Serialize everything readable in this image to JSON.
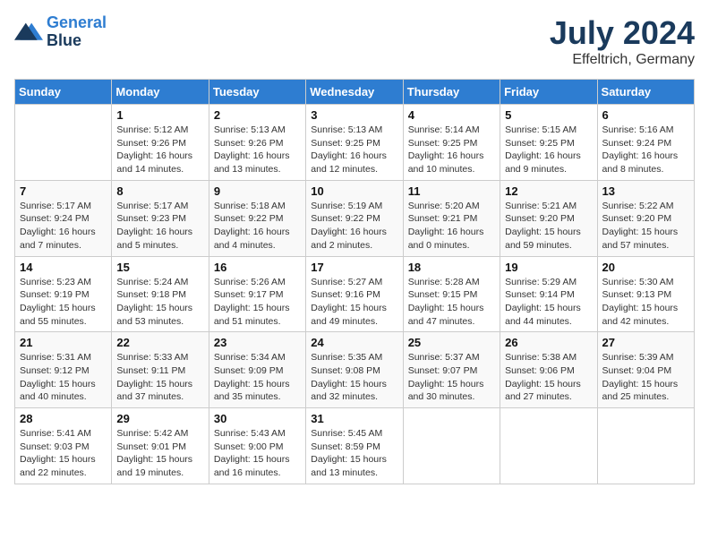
{
  "header": {
    "logo_line1": "General",
    "logo_line2": "Blue",
    "month_title": "July 2024",
    "subtitle": "Effeltrich, Germany"
  },
  "weekdays": [
    "Sunday",
    "Monday",
    "Tuesday",
    "Wednesday",
    "Thursday",
    "Friday",
    "Saturday"
  ],
  "weeks": [
    [
      {
        "day": "",
        "info": ""
      },
      {
        "day": "1",
        "info": "Sunrise: 5:12 AM\nSunset: 9:26 PM\nDaylight: 16 hours\nand 14 minutes."
      },
      {
        "day": "2",
        "info": "Sunrise: 5:13 AM\nSunset: 9:26 PM\nDaylight: 16 hours\nand 13 minutes."
      },
      {
        "day": "3",
        "info": "Sunrise: 5:13 AM\nSunset: 9:25 PM\nDaylight: 16 hours\nand 12 minutes."
      },
      {
        "day": "4",
        "info": "Sunrise: 5:14 AM\nSunset: 9:25 PM\nDaylight: 16 hours\nand 10 minutes."
      },
      {
        "day": "5",
        "info": "Sunrise: 5:15 AM\nSunset: 9:25 PM\nDaylight: 16 hours\nand 9 minutes."
      },
      {
        "day": "6",
        "info": "Sunrise: 5:16 AM\nSunset: 9:24 PM\nDaylight: 16 hours\nand 8 minutes."
      }
    ],
    [
      {
        "day": "7",
        "info": "Sunrise: 5:17 AM\nSunset: 9:24 PM\nDaylight: 16 hours\nand 7 minutes."
      },
      {
        "day": "8",
        "info": "Sunrise: 5:17 AM\nSunset: 9:23 PM\nDaylight: 16 hours\nand 5 minutes."
      },
      {
        "day": "9",
        "info": "Sunrise: 5:18 AM\nSunset: 9:22 PM\nDaylight: 16 hours\nand 4 minutes."
      },
      {
        "day": "10",
        "info": "Sunrise: 5:19 AM\nSunset: 9:22 PM\nDaylight: 16 hours\nand 2 minutes."
      },
      {
        "day": "11",
        "info": "Sunrise: 5:20 AM\nSunset: 9:21 PM\nDaylight: 16 hours\nand 0 minutes."
      },
      {
        "day": "12",
        "info": "Sunrise: 5:21 AM\nSunset: 9:20 PM\nDaylight: 15 hours\nand 59 minutes."
      },
      {
        "day": "13",
        "info": "Sunrise: 5:22 AM\nSunset: 9:20 PM\nDaylight: 15 hours\nand 57 minutes."
      }
    ],
    [
      {
        "day": "14",
        "info": "Sunrise: 5:23 AM\nSunset: 9:19 PM\nDaylight: 15 hours\nand 55 minutes."
      },
      {
        "day": "15",
        "info": "Sunrise: 5:24 AM\nSunset: 9:18 PM\nDaylight: 15 hours\nand 53 minutes."
      },
      {
        "day": "16",
        "info": "Sunrise: 5:26 AM\nSunset: 9:17 PM\nDaylight: 15 hours\nand 51 minutes."
      },
      {
        "day": "17",
        "info": "Sunrise: 5:27 AM\nSunset: 9:16 PM\nDaylight: 15 hours\nand 49 minutes."
      },
      {
        "day": "18",
        "info": "Sunrise: 5:28 AM\nSunset: 9:15 PM\nDaylight: 15 hours\nand 47 minutes."
      },
      {
        "day": "19",
        "info": "Sunrise: 5:29 AM\nSunset: 9:14 PM\nDaylight: 15 hours\nand 44 minutes."
      },
      {
        "day": "20",
        "info": "Sunrise: 5:30 AM\nSunset: 9:13 PM\nDaylight: 15 hours\nand 42 minutes."
      }
    ],
    [
      {
        "day": "21",
        "info": "Sunrise: 5:31 AM\nSunset: 9:12 PM\nDaylight: 15 hours\nand 40 minutes."
      },
      {
        "day": "22",
        "info": "Sunrise: 5:33 AM\nSunset: 9:11 PM\nDaylight: 15 hours\nand 37 minutes."
      },
      {
        "day": "23",
        "info": "Sunrise: 5:34 AM\nSunset: 9:09 PM\nDaylight: 15 hours\nand 35 minutes."
      },
      {
        "day": "24",
        "info": "Sunrise: 5:35 AM\nSunset: 9:08 PM\nDaylight: 15 hours\nand 32 minutes."
      },
      {
        "day": "25",
        "info": "Sunrise: 5:37 AM\nSunset: 9:07 PM\nDaylight: 15 hours\nand 30 minutes."
      },
      {
        "day": "26",
        "info": "Sunrise: 5:38 AM\nSunset: 9:06 PM\nDaylight: 15 hours\nand 27 minutes."
      },
      {
        "day": "27",
        "info": "Sunrise: 5:39 AM\nSunset: 9:04 PM\nDaylight: 15 hours\nand 25 minutes."
      }
    ],
    [
      {
        "day": "28",
        "info": "Sunrise: 5:41 AM\nSunset: 9:03 PM\nDaylight: 15 hours\nand 22 minutes."
      },
      {
        "day": "29",
        "info": "Sunrise: 5:42 AM\nSunset: 9:01 PM\nDaylight: 15 hours\nand 19 minutes."
      },
      {
        "day": "30",
        "info": "Sunrise: 5:43 AM\nSunset: 9:00 PM\nDaylight: 15 hours\nand 16 minutes."
      },
      {
        "day": "31",
        "info": "Sunrise: 5:45 AM\nSunset: 8:59 PM\nDaylight: 15 hours\nand 13 minutes."
      },
      {
        "day": "",
        "info": ""
      },
      {
        "day": "",
        "info": ""
      },
      {
        "day": "",
        "info": ""
      }
    ]
  ]
}
